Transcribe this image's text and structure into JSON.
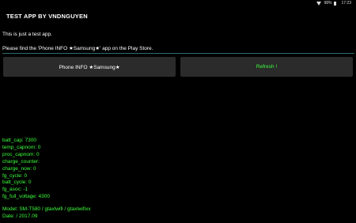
{
  "status_bar": {
    "battery": "98%",
    "time": "17:23",
    "wifi_icon": "wifi-icon",
    "battery_icon": "battery-icon"
  },
  "app_bar": {
    "title": "TEST APP BY VNDNGUYEN"
  },
  "content": {
    "line1": "This is just a test app.",
    "line2": "Please find the 'Phone INFO ★Samsung★' app on the Play Store."
  },
  "buttons": {
    "phone_info": "Phone INFO ★Samsung★",
    "refresh": "Refresh !"
  },
  "colors": {
    "accent_green": "#3cff3c",
    "button_bg": "#2b2b2b",
    "divider": "#2e6b6b"
  },
  "info": {
    "batt_cap": "batt_cap: 7300",
    "temp_capnom": "temp_capnom: 0",
    "proc_capnom": "proc_capnom: 0",
    "charge_counter": "charge_counter:",
    "charge_now": "charge_now: 0",
    "fg_cycle": "fg_cycle: 0",
    "batt_cycle": "batt_cycle: 0",
    "fg_asoc": "fg_asoc: -1",
    "fg_full_voltage": "fg_full_voltage: 4300",
    "model": "Model: SM-T580 / gtaxlwifi / gtaxlwifixx",
    "date": "Date: / 2017.09"
  }
}
